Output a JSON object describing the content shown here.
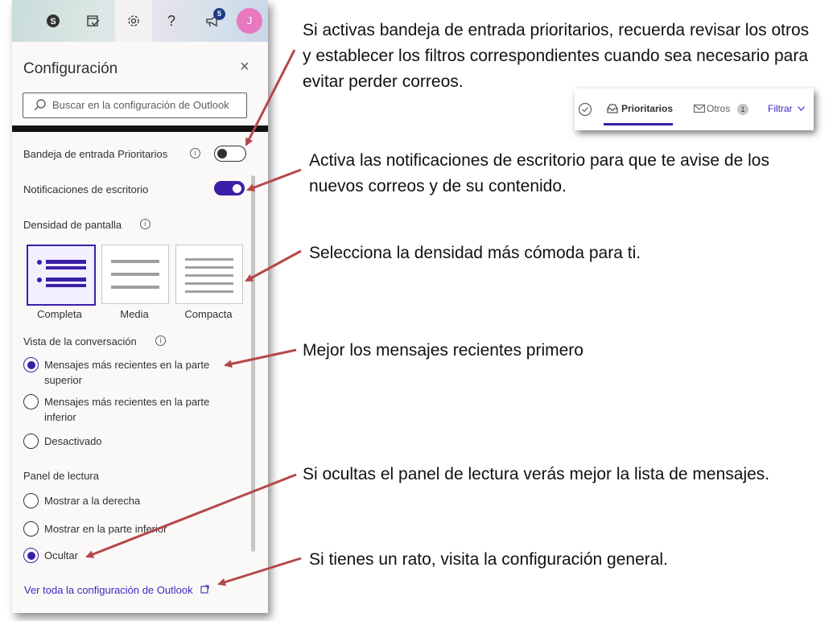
{
  "panel": {
    "title": "Configuración",
    "close_glyph": "×",
    "search_placeholder": "Buscar en la configuración de Outlook",
    "topbar": {
      "icons": [
        "skype-icon",
        "calendar-check-icon",
        "gear-icon",
        "help-icon",
        "megaphone-icon"
      ],
      "help_glyph": "?",
      "notifications_count": "5",
      "avatar_initial": "J"
    },
    "focused_inbox": {
      "label": "Bandeja de entrada Prioritarios",
      "enabled": false
    },
    "desktop_notifications": {
      "label": "Notificaciones de escritorio",
      "enabled": true
    },
    "density": {
      "label": "Densidad de pantalla",
      "options": [
        "Completa",
        "Media",
        "Compacta"
      ],
      "selected": "Completa"
    },
    "conversation": {
      "label": "Vista de la conversación",
      "options": [
        "Mensajes más recientes en la parte superior",
        "Mensajes más recientes en la parte inferior",
        "Desactivado"
      ],
      "selected": 0
    },
    "reading_pane": {
      "label": "Panel de lectura",
      "options": [
        "Mostrar a la derecha",
        "Mostrar en la parte inferior",
        "Ocultar"
      ],
      "selected": 2
    },
    "all_settings_link": "Ver toda la configuración de Outlook",
    "info_glyph": "i"
  },
  "focused_tabs": {
    "tab1": "Prioritarios",
    "tab2": "Otros",
    "tab2_count": "1",
    "filter": "Filtrar"
  },
  "annotations": {
    "a1": "Si activas bandeja de entrada prioritarios, recuerda revisar los otros y establecer los filtros correspondientes cuando sea necesario para evitar perder correos.",
    "a2": "Activa las notificaciones de escritorio para que te avise de los nuevos correos y de su contenido.",
    "a3": "Selecciona la densidad más cómoda para ti.",
    "a4": "Mejor los mensajes recientes primero",
    "a5": "Si ocultas el panel de lectura verás mejor la lista de mensajes.",
    "a6": "Si tienes un rato, visita la configuración general."
  },
  "colors": {
    "accent": "#3b1fa6",
    "arrow": "#b5484a",
    "link": "#3b2bbf"
  }
}
